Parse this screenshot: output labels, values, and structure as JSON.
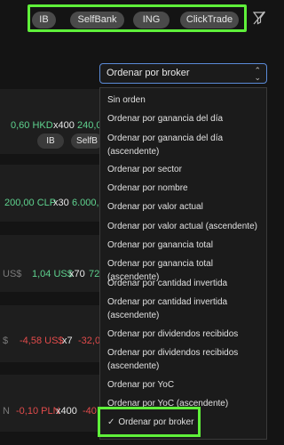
{
  "brokers": [
    "IB",
    "SelfBank",
    "ING",
    "ClickTrade"
  ],
  "sort_select": {
    "label": "Ordenar por broker"
  },
  "sort_options": [
    "Sin orden",
    "Ordenar por ganancia del día",
    "Ordenar por ganancia del día (ascendente)",
    "Ordenar por sector",
    "Ordenar por nombre",
    "Ordenar por valor actual",
    "Ordenar por valor actual (ascendente)",
    "Ordenar por ganancia total",
    "Ordenar por ganancia total (ascendente)",
    "Ordenar por cantidad invertida",
    "Ordenar por cantidad invertida (ascendente)",
    "Ordenar por dividendos recibidos",
    "Ordenar por dividendos recibidos (ascendente)",
    "Ordenar por YoC",
    "Ordenar por YoC (ascendente)",
    "Ordenar por broker"
  ],
  "selected_option": "Ordenar por broker",
  "cards": [
    {
      "price": "0,60 HKD",
      "qty": "x400",
      "total": "240,0",
      "tags": [
        "IB",
        "SelfB"
      ]
    },
    {
      "price": "200,00 CLP",
      "qty": "x30",
      "total": "6.000,0"
    },
    {
      "pre": "US$",
      "price": "1,04 US$",
      "qty": "x70",
      "total": "72"
    },
    {
      "pre": "$",
      "price": "-4,58 US$",
      "qty": "x7",
      "total": "-32,0"
    },
    {
      "pre": "N",
      "price": "-0,10 PLN",
      "qty": "x400",
      "total": "-40"
    }
  ]
}
